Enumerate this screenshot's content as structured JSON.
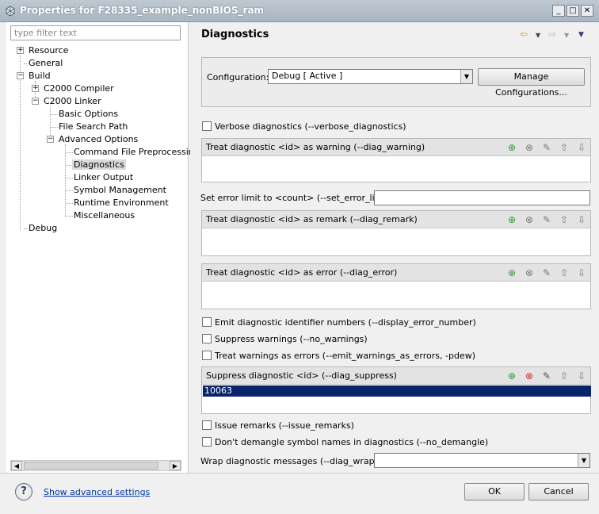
{
  "window": {
    "title": "Properties for F28335_example_nonBIOS_ram",
    "buttons": {
      "minimize": "_",
      "maximize": "□",
      "close": "✕"
    }
  },
  "filter": {
    "placeholder": "type filter text"
  },
  "tree": {
    "items": [
      {
        "label": "Resource",
        "twisty": "+"
      },
      {
        "label": "General"
      },
      {
        "label": "Build",
        "twisty": "−"
      },
      {
        "label": "C2000 Compiler",
        "twisty": "+"
      },
      {
        "label": "C2000 Linker",
        "twisty": "−"
      },
      {
        "label": "Basic Options"
      },
      {
        "label": "File Search Path"
      },
      {
        "label": "Advanced Options",
        "twisty": "−"
      },
      {
        "label": "Command File Preprocessing"
      },
      {
        "label": "Diagnostics",
        "selected": true
      },
      {
        "label": "Linker Output"
      },
      {
        "label": "Symbol Management"
      },
      {
        "label": "Runtime Environment"
      },
      {
        "label": "Miscellaneous"
      },
      {
        "label": "Debug"
      }
    ]
  },
  "page": {
    "title": "Diagnostics",
    "nav_back_icon": "arrow-left-icon",
    "nav_forward_icon": "arrow-right-icon",
    "menu_icon": "chevron-down-icon"
  },
  "config": {
    "label": "Configuration:",
    "value": "Debug  [ Active ]",
    "manage_button": "Manage Configurations..."
  },
  "options": {
    "verbose": "Verbose diagnostics (--verbose_diagnostics)",
    "diag_warning": "Treat diagnostic <id> as warning (--diag_warning)",
    "error_limit": "Set error limit to <count> (--set_error_limit)",
    "diag_remark": "Treat diagnostic <id> as remark (--diag_remark)",
    "diag_error": "Treat diagnostic <id> as error (--diag_error)",
    "emit_numbers": "Emit diagnostic identifier numbers (--display_error_number)",
    "suppress_warnings": "Suppress warnings (--no_warnings)",
    "warnings_as_errors": "Treat warnings as errors (--emit_warnings_as_errors, -pdew)",
    "diag_suppress": "Suppress diagnostic <id> (--diag_suppress)",
    "diag_suppress_values": [
      "10063"
    ],
    "issue_remarks": "Issue remarks (--issue_remarks)",
    "no_demangle": "Don't demangle symbol names in diagnostics (--no_demangle)",
    "diag_wrap": "Wrap diagnostic messages (--diag_wrap)",
    "diag_wrap_value": ""
  },
  "bottom": {
    "help_icon": "?",
    "advanced_link": "Show advanced settings",
    "ok": "OK",
    "cancel": "Cancel"
  }
}
